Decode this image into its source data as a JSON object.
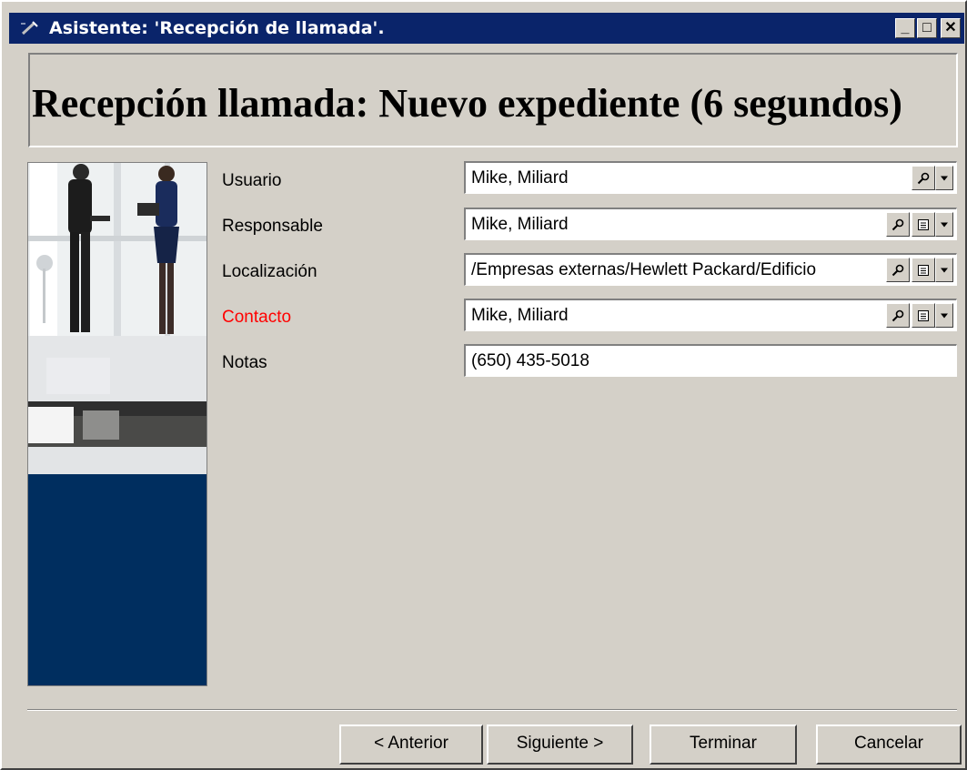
{
  "window": {
    "title": "Asistente: 'Recepción de llamada'.",
    "controls": {
      "minimize": "_",
      "maximize": "□",
      "close": "✕"
    }
  },
  "header": {
    "title": "Recepción llamada: Nuevo expediente (6 segundos)"
  },
  "form": {
    "fields": [
      {
        "label": "Usuario",
        "value": "Mike, Miliard",
        "label_color": "#000000"
      },
      {
        "label": "Responsable",
        "value": "Mike, Miliard",
        "label_color": "#000000"
      },
      {
        "label": "Localización",
        "value": "/Empresas externas/Hewlett Packard/Edificio",
        "label_color": "#000000"
      },
      {
        "label": "Contacto",
        "value": "Mike, Miliard",
        "label_color": "#ff0000"
      },
      {
        "label": "Notas",
        "value": "(650) 435-5018",
        "label_color": "#000000"
      }
    ]
  },
  "buttons": {
    "previous": "< Anterior",
    "next": "Siguiente >",
    "finish": "Terminar",
    "cancel": "Cancelar"
  },
  "colors": {
    "titlebar": "#0a246a",
    "window_bg": "#d4d0c8",
    "side_panel_blue": "#002e5f",
    "required_label": "#ff0000"
  },
  "icons": {
    "title": "wand-icon",
    "search": "magnifier-icon",
    "detail": "form-detail-icon",
    "dropdown": "chevron-down-icon"
  }
}
